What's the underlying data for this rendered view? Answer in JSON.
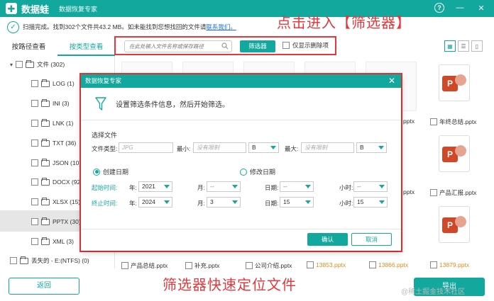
{
  "app": {
    "name": "数据蛙",
    "subtitle": "数据恢复专家",
    "help_icon": "help-icon",
    "minimize_icon": "minimize-icon",
    "close_icon": "close-icon"
  },
  "status": {
    "text": "扫描完成。找到302个文件共43.2 MB。如未能找到您想找回的文件请",
    "link": "联系我们。"
  },
  "annotations": {
    "top": "点击进入【筛选器】",
    "bottom": "筛选器快速定位文件"
  },
  "tabs": [
    {
      "label": "按路径查看",
      "active": false
    },
    {
      "label": "按类型查看",
      "active": true
    }
  ],
  "toolbar": {
    "search_placeholder": "在此处输入文件名称或保存路径",
    "filter_button": "筛选器",
    "only_deleted": "仅显示删除项"
  },
  "tree": [
    {
      "label": "文件 (302)",
      "level": 0
    },
    {
      "label": "LOG (1)",
      "level": 1
    },
    {
      "label": "INI (3)",
      "level": 1
    },
    {
      "label": "LNK (1)",
      "level": 1
    },
    {
      "label": "TXT (36)",
      "level": 1
    },
    {
      "label": "JSON (10)",
      "level": 1
    },
    {
      "label": "DOCX (92)",
      "level": 1
    },
    {
      "label": "XLSX (15)",
      "level": 1
    },
    {
      "label": "PPTX (30)",
      "level": 1,
      "selected": true
    },
    {
      "label": "XML (3)",
      "level": 1
    },
    {
      "label": "丢失的 - E:(NTFS) (0)",
      "level": 0
    }
  ],
  "files": {
    "top_right_1": "年终总结.pptx",
    "top_right_2": "产品汇报.pptx",
    "partial_1": "pptx",
    "partial_2": "pptx",
    "bottom": [
      {
        "name": "产品总结.pptx",
        "deleted": false
      },
      {
        "name": "补充.pptx",
        "deleted": false
      },
      {
        "name": "公司介绍.pptx",
        "deleted": false
      },
      {
        "name": "13853.pptx",
        "deleted": true
      },
      {
        "name": "13866.pptx",
        "deleted": true
      },
      {
        "name": "13879.pptx",
        "deleted": true
      }
    ]
  },
  "buttons": {
    "back": "返回",
    "export": "导出"
  },
  "watermark": "@稀土掘金技术社区",
  "modal": {
    "title": "数据恢复专家",
    "header": "设置筛选条件信息，然后开始筛选。",
    "section": "选择文件",
    "file_type_label": "文件类型:",
    "file_type_placeholder": "JPG",
    "min_label": "最小:",
    "min_placeholder": "没有限制",
    "min_unit": "B",
    "max_label": "最大:",
    "max_placeholder": "没有限制",
    "max_unit": "B",
    "created_date": "创建日期",
    "modified_date": "修改日期",
    "start_label": "起始时间:",
    "end_label": "终止时间:",
    "year_label": "年:",
    "month_label": "月:",
    "day_label": "日期:",
    "hour_label": "小时:",
    "start": {
      "year": "2021",
      "month": "--",
      "day": "--",
      "hour": "--"
    },
    "end": {
      "year": "2024",
      "month": "3",
      "day": "15",
      "hour": "15"
    },
    "ok": "确认",
    "cancel": "取消"
  },
  "colors": {
    "accent": "#13a89e",
    "annotation": "#e8373a",
    "deleted_file": "#e38a1f"
  }
}
